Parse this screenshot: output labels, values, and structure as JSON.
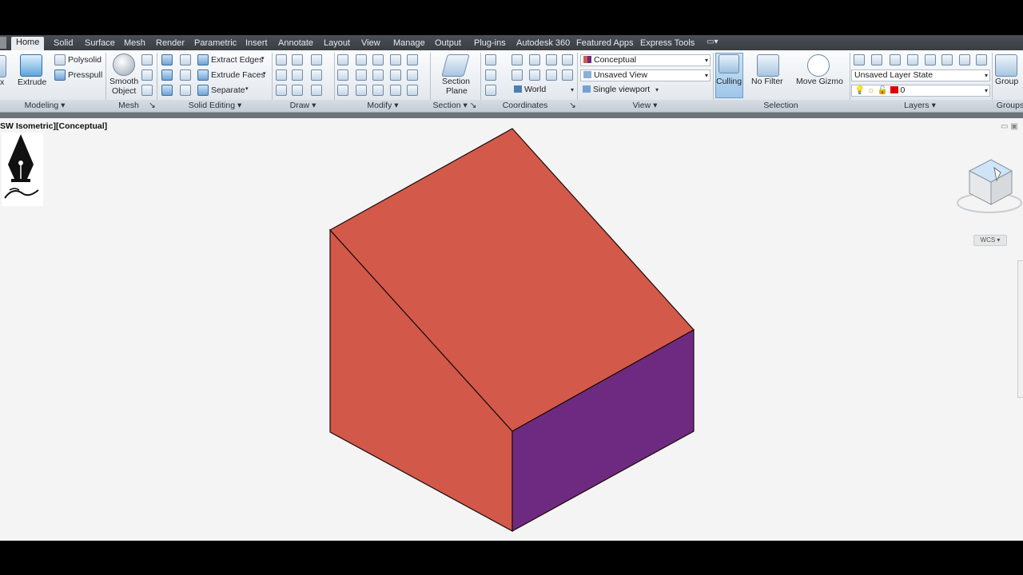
{
  "ribbon": {
    "tabs": [
      {
        "label": "Home",
        "active": true
      },
      {
        "label": "Solid"
      },
      {
        "label": "Surface"
      },
      {
        "label": "Mesh"
      },
      {
        "label": "Render"
      },
      {
        "label": "Parametric"
      },
      {
        "label": "Insert"
      },
      {
        "label": "Annotate"
      },
      {
        "label": "Layout"
      },
      {
        "label": "View"
      },
      {
        "label": "Manage"
      },
      {
        "label": "Output"
      },
      {
        "label": "Plug-ins"
      },
      {
        "label": "Autodesk 360"
      },
      {
        "label": "Featured Apps"
      },
      {
        "label": "Express Tools"
      }
    ],
    "modeling": {
      "box_partial": "x",
      "extrude": "Extrude",
      "polysolid": "Polysolid",
      "presspull": "Presspull",
      "title": "Modeling"
    },
    "mesh": {
      "smooth_object_1": "Smooth",
      "smooth_object_2": "Object",
      "title": "Mesh"
    },
    "solid_editing": {
      "extract_edges": "Extract Edges",
      "extrude_faces": "Extrude Faces",
      "separate": "Separate",
      "title": "Solid Editing"
    },
    "draw": {
      "title": "Draw"
    },
    "modify": {
      "title": "Modify"
    },
    "section": {
      "label_1": "Section",
      "label_2": "Plane",
      "title": "Section"
    },
    "coordinates": {
      "ucs_world": "World",
      "title": "Coordinates"
    },
    "view": {
      "visual_style": "Conceptual",
      "saved_view": "Unsaved View",
      "viewport_config": "Single viewport",
      "title": "View"
    },
    "selection": {
      "culling": "Culling",
      "no_filter": "No Filter",
      "move_gizmo": "Move Gizmo",
      "title": "Selection"
    },
    "layers": {
      "layer_state": "Unsaved Layer State",
      "current_layer": "0",
      "layer_color": "#e00000",
      "title": "Layers"
    },
    "groups": {
      "group": "Group",
      "title": "Groups"
    }
  },
  "viewport": {
    "label": "SW Isometric][Conceptual]",
    "wcs": "WCS",
    "colors": {
      "top": "#d35a4a",
      "front": "#d2584a",
      "side": "#6e2a80",
      "edge": "#1a0a0a"
    }
  }
}
